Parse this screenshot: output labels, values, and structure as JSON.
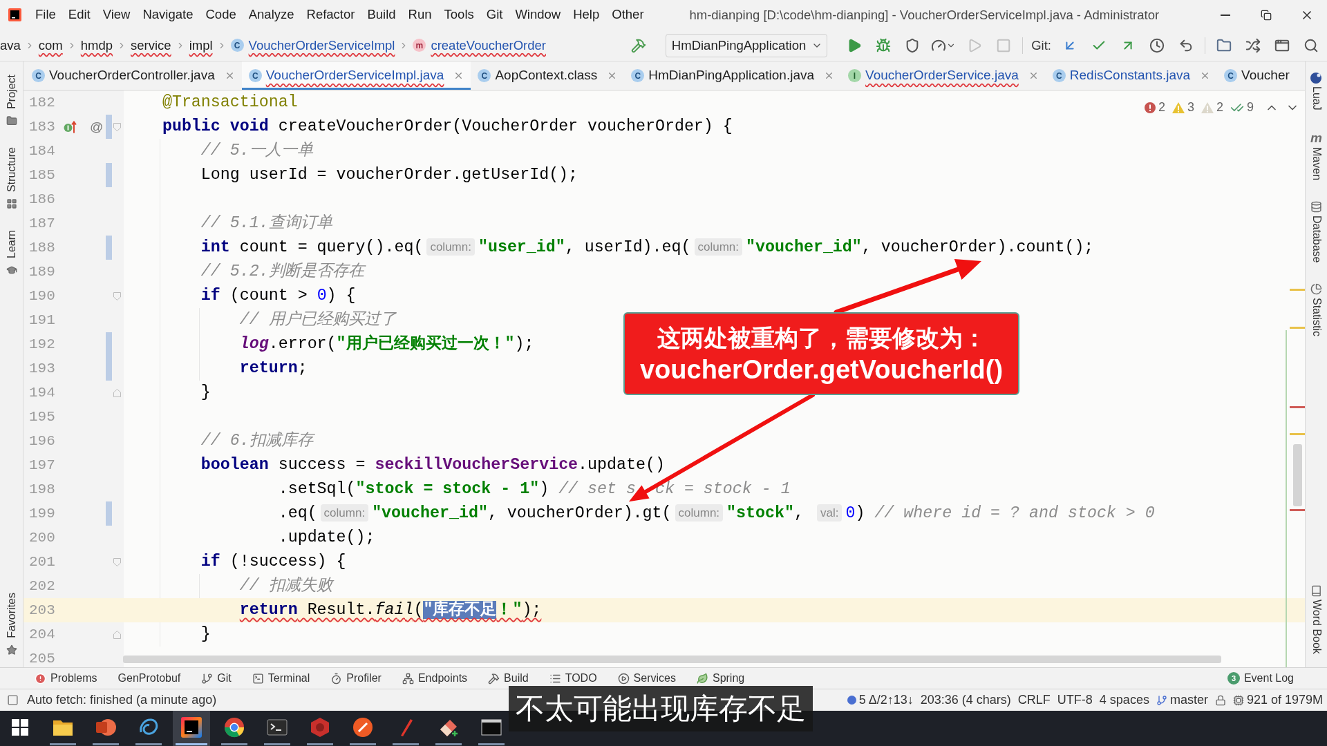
{
  "window": {
    "title": "hm-dianping [D:\\code\\hm-dianping] - VoucherOrderServiceImpl.java - Administrator"
  },
  "menu": [
    "File",
    "Edit",
    "View",
    "Navigate",
    "Code",
    "Analyze",
    "Refactor",
    "Build",
    "Run",
    "Tools",
    "Git",
    "Window",
    "Help",
    "Other"
  ],
  "breadcrumbs": [
    {
      "label": "ava",
      "kind": "folder",
      "modified": false,
      "error": false
    },
    {
      "label": "com",
      "kind": "folder",
      "modified": false,
      "error": true
    },
    {
      "label": "hmdp",
      "kind": "folder",
      "modified": false,
      "error": true
    },
    {
      "label": "service",
      "kind": "folder",
      "modified": false,
      "error": true
    },
    {
      "label": "impl",
      "kind": "folder",
      "modified": false,
      "error": true
    },
    {
      "label": "VoucherOrderServiceImpl",
      "kind": "class",
      "icon": "C",
      "modified": true,
      "error": true
    },
    {
      "label": "createVoucherOrder",
      "kind": "method",
      "icon": "m",
      "modified": true,
      "error": true
    }
  ],
  "toolbar": [
    {
      "kind": "build",
      "disabled": false
    },
    {
      "kind": "run_config",
      "label": "HmDianPingApplication"
    },
    {
      "kind": "run",
      "disabled": false
    },
    {
      "kind": "debug",
      "disabled": false
    },
    {
      "kind": "coverage",
      "disabled": false
    },
    {
      "kind": "profiler",
      "disabled": false
    },
    {
      "kind": "rerun",
      "disabled": true
    },
    {
      "kind": "stop",
      "disabled": true
    },
    {
      "kind": "separator"
    },
    {
      "kind": "vcs_label",
      "label": "Git:"
    },
    {
      "kind": "update",
      "disabled": false
    },
    {
      "kind": "commit",
      "disabled": false
    },
    {
      "kind": "push",
      "disabled": false
    },
    {
      "kind": "history",
      "disabled": false
    },
    {
      "kind": "rollback",
      "disabled": false
    },
    {
      "kind": "separator"
    },
    {
      "kind": "project_structure",
      "disabled": false
    },
    {
      "kind": "shuffle",
      "disabled": false
    },
    {
      "kind": "window",
      "disabled": false
    },
    {
      "kind": "search",
      "disabled": false
    }
  ],
  "tabs": [
    {
      "label": "VoucherOrderController.java",
      "icon": "C",
      "kind": "class",
      "selected": false,
      "modified": false,
      "error": false,
      "closable": true
    },
    {
      "label": "VoucherOrderServiceImpl.java",
      "icon": "C",
      "kind": "class",
      "selected": true,
      "modified": true,
      "error": true,
      "closable": true
    },
    {
      "label": "AopContext.class",
      "icon": "C",
      "kind": "class",
      "selected": false,
      "modified": false,
      "error": false,
      "closable": true
    },
    {
      "label": "HmDianPingApplication.java",
      "icon": "C",
      "kind": "class",
      "selected": false,
      "modified": false,
      "error": false,
      "closable": true
    },
    {
      "label": "VoucherOrderService.java",
      "icon": "I",
      "kind": "interface",
      "selected": false,
      "modified": true,
      "error": true,
      "closable": true
    },
    {
      "label": "RedisConstants.java",
      "icon": "C",
      "kind": "class",
      "selected": false,
      "modified": true,
      "error": false,
      "closable": true
    },
    {
      "label": "Voucher",
      "icon": "C",
      "kind": "class",
      "selected": false,
      "modified": false,
      "error": false,
      "closable": false
    }
  ],
  "inspections": [
    {
      "kind": "error",
      "count": "2"
    },
    {
      "kind": "warning",
      "count": "3"
    },
    {
      "kind": "weak_warning",
      "count": "2"
    },
    {
      "kind": "typo",
      "count": "9"
    }
  ],
  "left_tools": [
    {
      "label": "Project",
      "kind": "project"
    },
    {
      "label": "Structure",
      "kind": "structure"
    },
    {
      "label": "Learn",
      "kind": "learn"
    },
    {
      "label": "Favorites",
      "kind": "favorites"
    }
  ],
  "right_tools": [
    {
      "label": "LuaJ",
      "kind": "lua"
    },
    {
      "label": "Maven",
      "kind": "maven",
      "icon": "m"
    },
    {
      "label": "Database",
      "kind": "database"
    },
    {
      "label": "Statistic",
      "kind": "statistic"
    },
    {
      "label": "Word Book",
      "kind": "wordbook"
    }
  ],
  "editor": {
    "lines": [
      {
        "number": "182",
        "current": false,
        "changed": false,
        "segments": [
          {
            "text": "    @Transactional",
            "kind": "annotation"
          }
        ]
      },
      {
        "number": "183",
        "current": false,
        "changed": true,
        "gutter": [
          {
            "kind": "implements"
          },
          {
            "kind": "symbol",
            "text": "@"
          },
          {
            "kind": "fold_start"
          }
        ],
        "segments": [
          {
            "text": "    public void",
            "kind": "keyword"
          },
          {
            "text": " createVoucherOrder(VoucherOrder voucherOrder) {",
            "kind": "plain"
          }
        ]
      },
      {
        "number": "184",
        "current": false,
        "changed": false,
        "segments": [
          {
            "text": "        // 5.一人一单",
            "kind": "comment"
          }
        ]
      },
      {
        "number": "185",
        "current": false,
        "changed": true,
        "segments": [
          {
            "text": "        Long userId = voucherOrder.getUserId();",
            "kind": "plain"
          }
        ]
      },
      {
        "number": "186",
        "current": false,
        "changed": false
      },
      {
        "number": "187",
        "current": false,
        "changed": false,
        "segments": [
          {
            "text": "        // 5.1.查询订单",
            "kind": "comment"
          }
        ]
      },
      {
        "number": "188",
        "current": false,
        "changed": true,
        "segments": [
          {
            "text": "        int",
            "kind": "keyword"
          },
          {
            "text": " count = query().eq(",
            "kind": "plain"
          },
          {
            "text": "column:",
            "kind": "hint"
          },
          {
            "text": "\"user_id\"",
            "kind": "string"
          },
          {
            "text": ", userId).eq(",
            "kind": "plain"
          },
          {
            "text": "column:",
            "kind": "hint"
          },
          {
            "text": "\"voucher_id\"",
            "kind": "string"
          },
          {
            "text": ", voucherOrder).count();",
            "kind": "plain"
          }
        ]
      },
      {
        "number": "189",
        "current": false,
        "changed": false,
        "segments": [
          {
            "text": "        // 5.2.判断是否存在",
            "kind": "comment"
          }
        ]
      },
      {
        "number": "190",
        "current": false,
        "changed": false,
        "gutter": [
          {
            "kind": "fold_start"
          }
        ],
        "segments": [
          {
            "text": "        if",
            "kind": "keyword"
          },
          {
            "text": " (count > ",
            "kind": "plain"
          },
          {
            "text": "0",
            "kind": "number"
          },
          {
            "text": ") {",
            "kind": "plain"
          }
        ]
      },
      {
        "number": "191",
        "current": false,
        "changed": false,
        "segments": [
          {
            "text": "            // 用户已经购买过了",
            "kind": "comment"
          }
        ]
      },
      {
        "number": "192",
        "current": false,
        "changed": true,
        "segments": [
          {
            "text": "            log",
            "kind": "field"
          },
          {
            "text": ".error(",
            "kind": "plain"
          },
          {
            "text": "\"用户已经购买过一次！\"",
            "kind": "string"
          },
          {
            "text": ");",
            "kind": "plain"
          }
        ]
      },
      {
        "number": "193",
        "current": false,
        "changed": true,
        "segments": [
          {
            "text": "            return",
            "kind": "keyword"
          },
          {
            "text": ";",
            "kind": "plain"
          }
        ]
      },
      {
        "number": "194",
        "current": false,
        "changed": false,
        "gutter": [
          {
            "kind": "fold_end"
          }
        ],
        "segments": [
          {
            "text": "        }",
            "kind": "plain"
          }
        ]
      },
      {
        "number": "195",
        "current": false,
        "changed": false
      },
      {
        "number": "196",
        "current": false,
        "changed": false,
        "segments": [
          {
            "text": "        // 6.扣减库存",
            "kind": "comment"
          }
        ]
      },
      {
        "number": "197",
        "current": false,
        "changed": false,
        "segments": [
          {
            "text": "        boolean",
            "kind": "keyword"
          },
          {
            "text": " success = ",
            "kind": "plain"
          },
          {
            "text": "seckillVoucherService",
            "kind": "static_field"
          },
          {
            "text": ".update()",
            "kind": "plain"
          }
        ]
      },
      {
        "number": "198",
        "current": false,
        "changed": false,
        "segments": [
          {
            "text": "                .setSql(",
            "kind": "plain"
          },
          {
            "text": "\"stock = stock - 1\"",
            "kind": "string"
          },
          {
            "text": ") ",
            "kind": "plain"
          },
          {
            "text": "// set s  ",
            "kind": "comment"
          },
          {
            "text": "ck = stock - 1",
            "kind": "comment"
          }
        ]
      },
      {
        "number": "199",
        "current": false,
        "changed": true,
        "segments": [
          {
            "text": "                .eq(",
            "kind": "plain"
          },
          {
            "text": "column:",
            "kind": "hint"
          },
          {
            "text": "\"voucher_id\"",
            "kind": "string"
          },
          {
            "text": ", voucherOrder).gt(",
            "kind": "plain"
          },
          {
            "text": "column:",
            "kind": "hint"
          },
          {
            "text": "\"stock\"",
            "kind": "string"
          },
          {
            "text": ", ",
            "kind": "plain"
          },
          {
            "text": "val:",
            "kind": "hint"
          },
          {
            "text": "0",
            "kind": "number"
          },
          {
            "text": ") ",
            "kind": "plain"
          },
          {
            "text": "// where id = ? and stock > 0",
            "kind": "comment"
          }
        ]
      },
      {
        "number": "200",
        "current": false,
        "changed": false,
        "segments": [
          {
            "text": "                .update();",
            "kind": "plain"
          }
        ]
      },
      {
        "number": "201",
        "current": false,
        "changed": false,
        "gutter": [
          {
            "kind": "fold_start"
          }
        ],
        "segments": [
          {
            "text": "        if",
            "kind": "keyword"
          },
          {
            "text": " (!success) {",
            "kind": "plain"
          }
        ]
      },
      {
        "number": "202",
        "current": false,
        "changed": false,
        "segments": [
          {
            "text": "            // 扣减失败",
            "kind": "comment"
          }
        ]
      },
      {
        "number": "203",
        "current": true,
        "changed": false,
        "error": true,
        "segments": [
          {
            "text": "            return",
            "kind": "keyword"
          },
          {
            "text": " Result.",
            "kind": "plain"
          },
          {
            "text": "fail",
            "kind": "static_method"
          },
          {
            "text": "(",
            "kind": "plain"
          },
          {
            "text": "\"库存不足",
            "kind": "string_selected"
          },
          {
            "text": "！\"",
            "kind": "string"
          },
          {
            "text": ");",
            "kind": "plain"
          }
        ]
      },
      {
        "number": "204",
        "current": false,
        "changed": false,
        "gutter": [
          {
            "kind": "fold_end"
          }
        ],
        "segments": [
          {
            "text": "        }",
            "kind": "plain"
          }
        ]
      },
      {
        "number": "205",
        "current": false,
        "changed": false
      }
    ]
  },
  "annotation": {
    "lines": [
      "这两处被重构了，需要修改为：",
      "voucherOrder.getVoucherId()"
    ]
  },
  "tool_windows": [
    {
      "label": "Problems",
      "kind": "problems"
    },
    {
      "label": "GenProtobuf",
      "kind": "plain"
    },
    {
      "label": "Git",
      "kind": "git"
    },
    {
      "label": "Terminal",
      "kind": "terminal"
    },
    {
      "label": "Profiler",
      "kind": "profiler"
    },
    {
      "label": "Endpoints",
      "kind": "endpoints"
    },
    {
      "label": "Build",
      "kind": "build"
    },
    {
      "label": "TODO",
      "kind": "todo"
    },
    {
      "label": "Services",
      "kind": "services"
    },
    {
      "label": "Spring",
      "kind": "spring"
    }
  ],
  "event_log": {
    "label": "Event Log",
    "badge": "3"
  },
  "status_bar": {
    "message": "Auto fetch: finished (a minute ago)",
    "items": [
      {
        "kind": "vcs_changes",
        "text": "5 Δ/2↑13↓"
      },
      {
        "kind": "position",
        "text": "203:36 (4 chars)"
      },
      {
        "kind": "line_separator",
        "text": "CRLF"
      },
      {
        "kind": "encoding",
        "text": "UTF-8"
      },
      {
        "kind": "indent",
        "text": "4 spaces"
      },
      {
        "kind": "branch",
        "text": "master"
      },
      {
        "kind": "lock"
      },
      {
        "kind": "memory",
        "text": "921 of 1979M"
      }
    ]
  },
  "taskbar": [
    {
      "kind": "start",
      "selected": false,
      "running": false
    },
    {
      "kind": "explorer",
      "selected": false,
      "running": true
    },
    {
      "kind": "presentation",
      "selected": false,
      "running": true
    },
    {
      "kind": "swirl",
      "selected": false,
      "running": true
    },
    {
      "kind": "ide",
      "selected": true,
      "running": true
    },
    {
      "kind": "browser",
      "selected": false,
      "running": true
    },
    {
      "kind": "terminal",
      "selected": false,
      "running": true
    },
    {
      "kind": "hexagon",
      "selected": false,
      "running": true
    },
    {
      "kind": "round",
      "selected": false,
      "running": true
    },
    {
      "kind": "pen",
      "selected": false,
      "running": true
    },
    {
      "kind": "tile",
      "selected": false,
      "running": true
    },
    {
      "kind": "console",
      "selected": false,
      "running": true
    }
  ],
  "subtitle": {
    "text": "不太可能出现库存不足"
  }
}
